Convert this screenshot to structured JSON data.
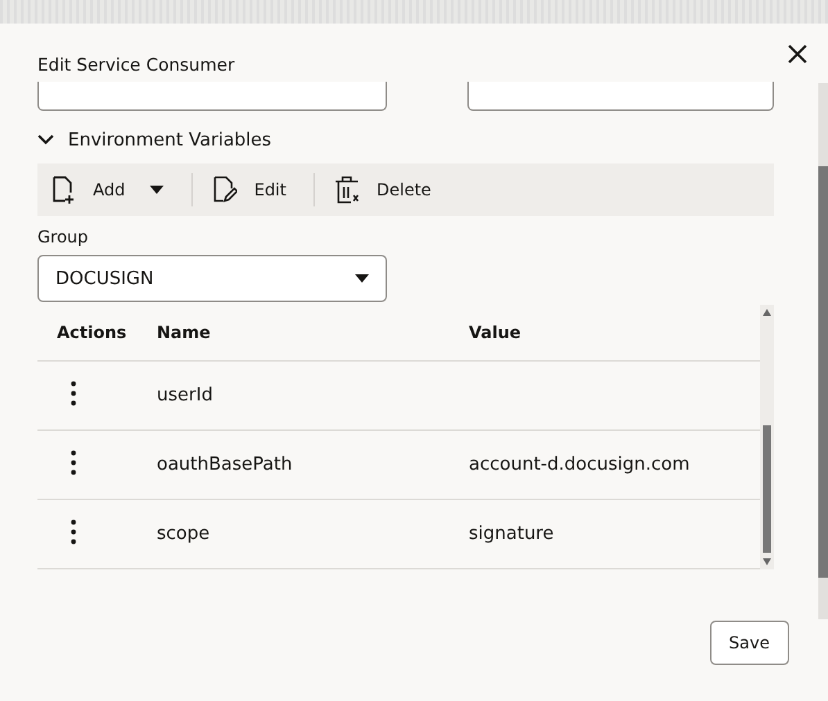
{
  "dialog": {
    "title": "Edit Service Consumer"
  },
  "section": {
    "label": "Environment Variables",
    "expanded": true
  },
  "toolbar": [
    {
      "kind": "add",
      "label": "Add"
    },
    {
      "kind": "edit",
      "label": "Edit"
    },
    {
      "kind": "delete",
      "label": "Delete"
    }
  ],
  "group": {
    "label": "Group",
    "value": "DOCUSIGN"
  },
  "table": {
    "columns": [
      "Actions",
      "Name",
      "Value"
    ],
    "rows": [
      {
        "name": "userId",
        "value": ""
      },
      {
        "name": "oauthBasePath",
        "value": "account-d.docusign.com"
      },
      {
        "name": "scope",
        "value": "signature"
      }
    ]
  },
  "buttons": [
    "Save"
  ]
}
